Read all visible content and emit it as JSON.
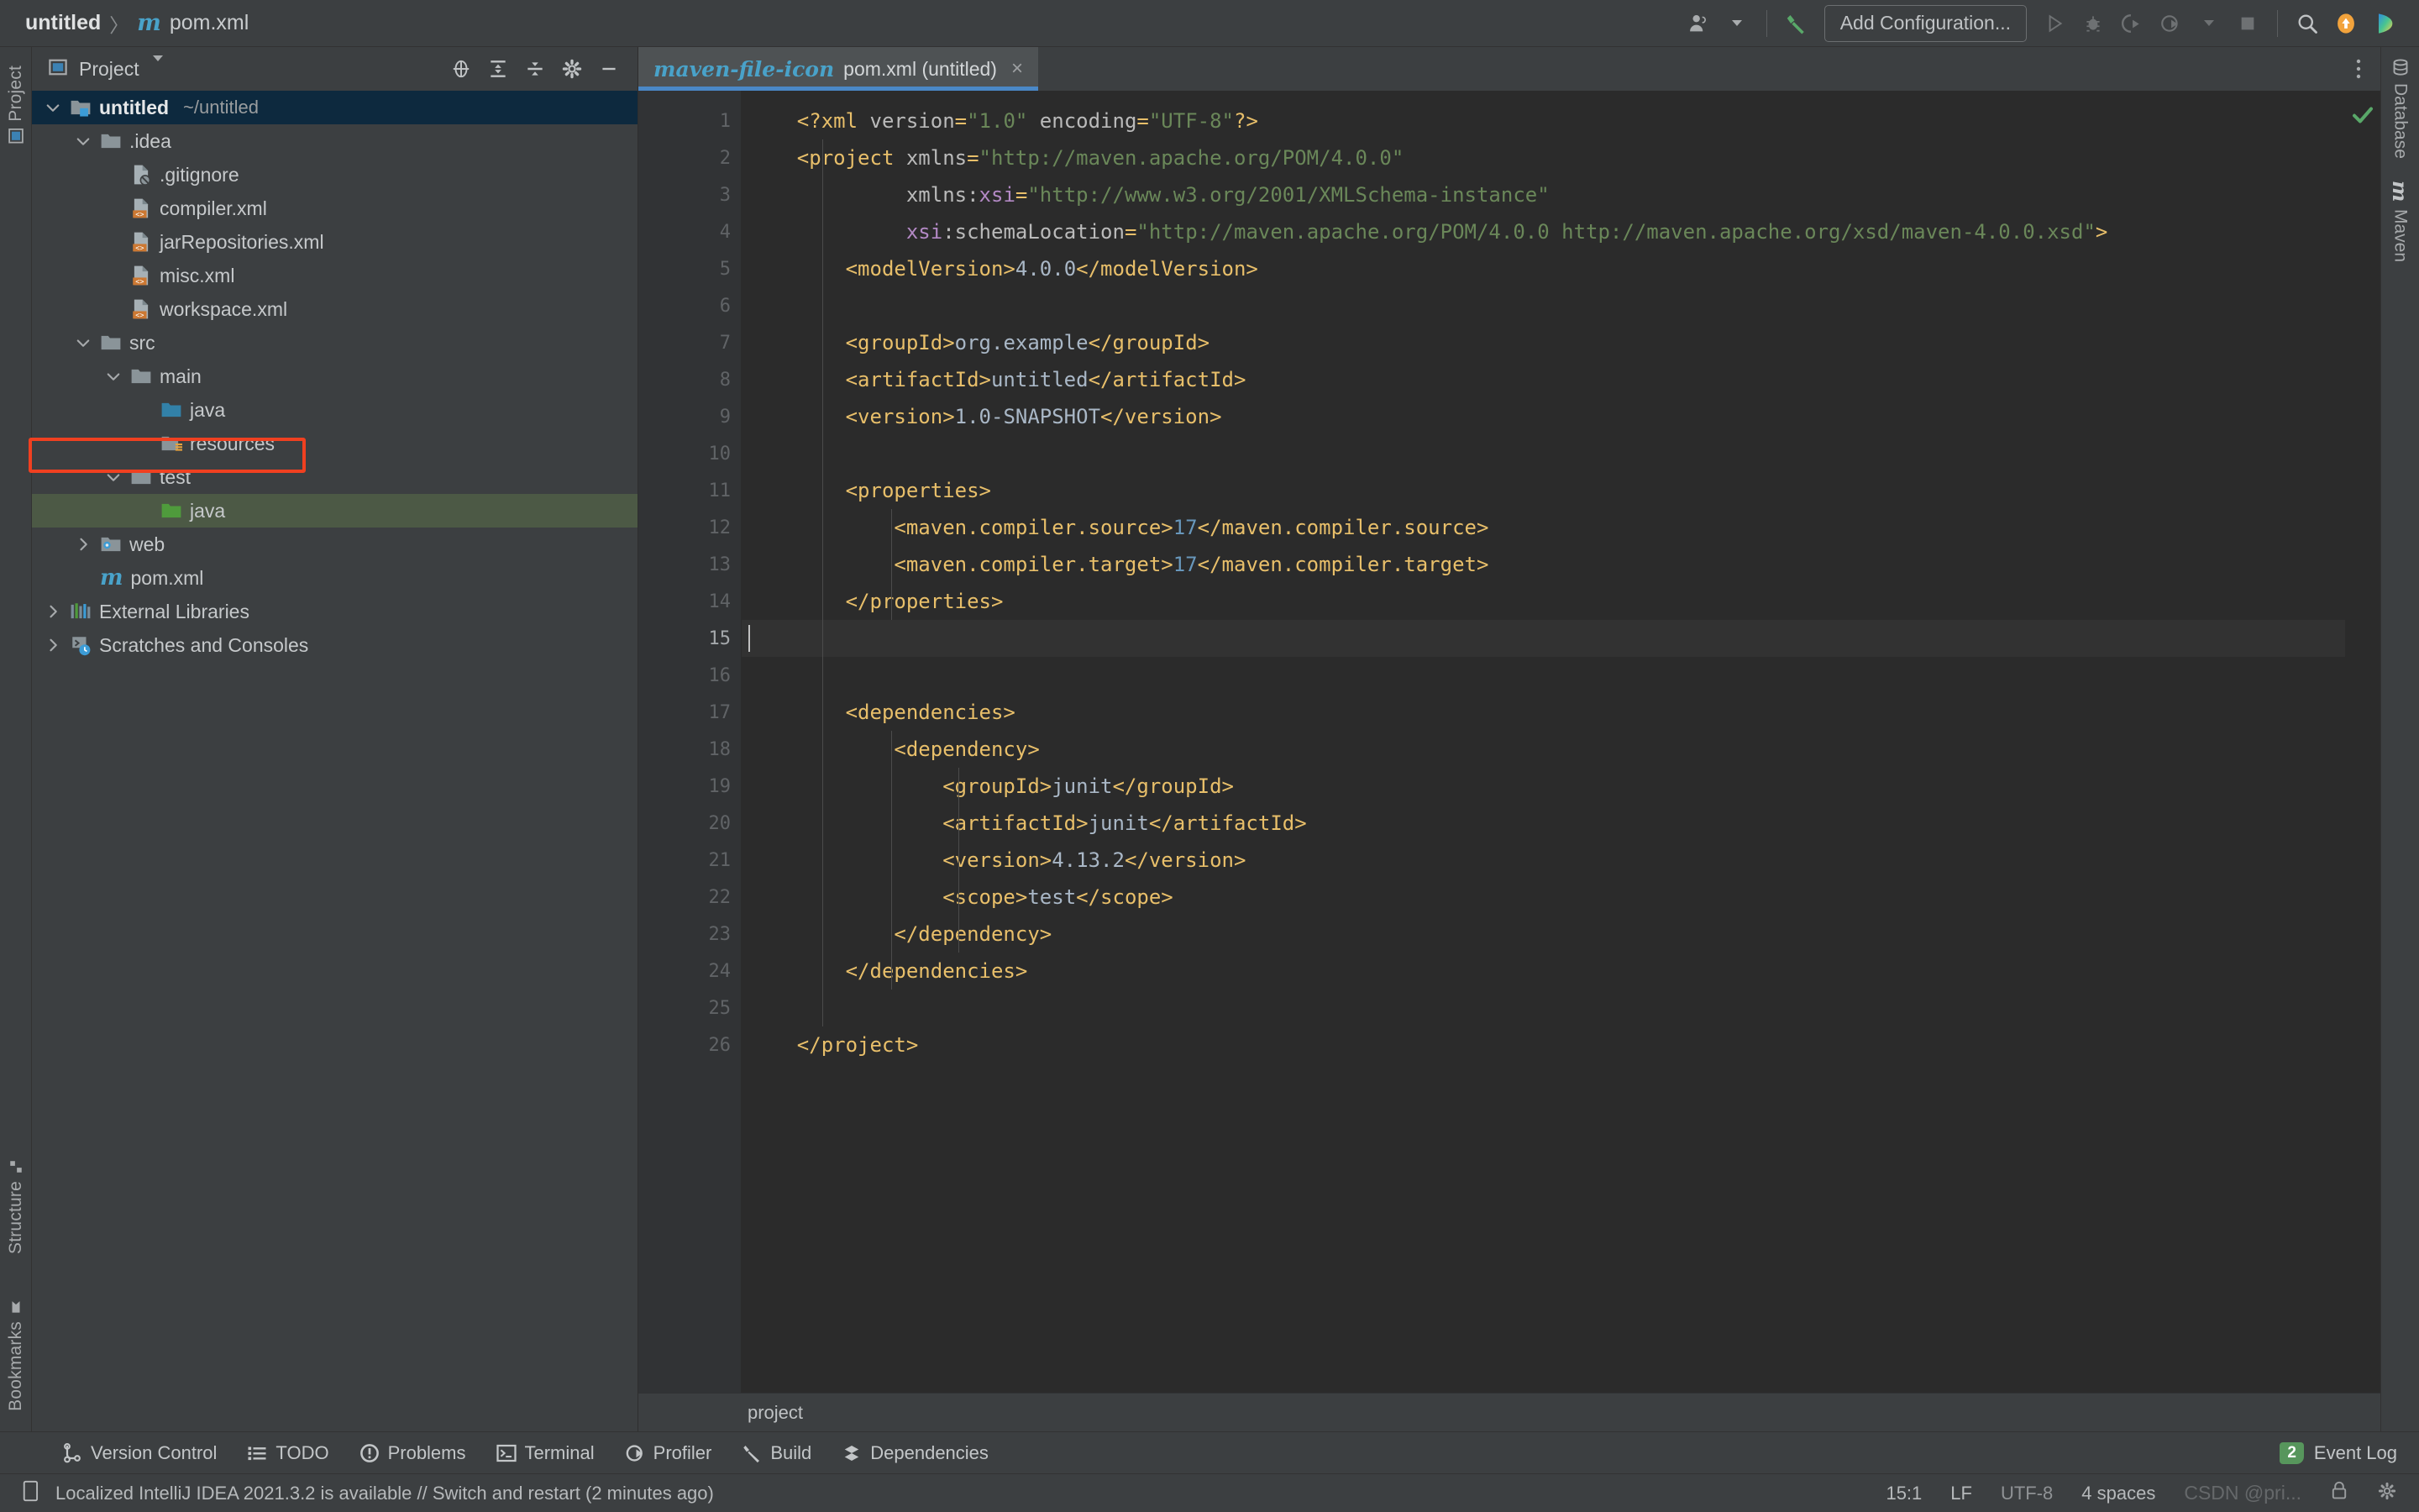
{
  "titlebar": {
    "project_name": "untitled",
    "separator": "〉",
    "file_icon": "m",
    "file_name": "pom.xml",
    "account_icon": "user-account-icon",
    "build_icon": "build-hammer-icon",
    "add_configuration_label": "Add Configuration...",
    "run_icon": "run-icon",
    "debug_icon": "debug-icon",
    "run_coverage_icon": "run-with-coverage-icon",
    "profile_icon": "profile-icon",
    "stop_icon": "stop-icon",
    "search_icon": "search-everywhere-icon",
    "updates_icon": "update-available-icon",
    "ide_icon": "ide-logo-icon"
  },
  "left_strip": {
    "project_label": "Project",
    "structure_label": "Structure",
    "bookmarks_label": "Bookmarks"
  },
  "project_panel": {
    "header_title": "Project",
    "header_dropdown": "▼",
    "icons": [
      {
        "name": "select-opened-file-icon"
      },
      {
        "name": "expand-all-icon"
      },
      {
        "name": "collapse-all-icon"
      },
      {
        "name": "settings-gear-icon"
      },
      {
        "name": "hide-panel-icon"
      }
    ],
    "tree": [
      {
        "depth": 0,
        "arrow": "down",
        "icon": "module-folder-icon",
        "label": "untitled",
        "sub": "~/untitled",
        "bold": true,
        "state": "selected-blue"
      },
      {
        "depth": 1,
        "arrow": "down",
        "icon": "folder-icon",
        "label": ".idea",
        "sub": "",
        "bold": false,
        "state": "none"
      },
      {
        "depth": 2,
        "arrow": "none",
        "icon": "gitignore-file-icon",
        "label": ".gitignore",
        "sub": "",
        "bold": false,
        "state": "none"
      },
      {
        "depth": 2,
        "arrow": "none",
        "icon": "xml-file-icon",
        "label": "compiler.xml",
        "sub": "",
        "bold": false,
        "state": "none"
      },
      {
        "depth": 2,
        "arrow": "none",
        "icon": "xml-file-icon",
        "label": "jarRepositories.xml",
        "sub": "",
        "bold": false,
        "state": "none"
      },
      {
        "depth": 2,
        "arrow": "none",
        "icon": "xml-file-icon",
        "label": "misc.xml",
        "sub": "",
        "bold": false,
        "state": "none"
      },
      {
        "depth": 2,
        "arrow": "none",
        "icon": "xml-file-icon",
        "label": "workspace.xml",
        "sub": "",
        "bold": false,
        "state": "none"
      },
      {
        "depth": 1,
        "arrow": "down",
        "icon": "folder-icon",
        "label": "src",
        "sub": "",
        "bold": false,
        "state": "none"
      },
      {
        "depth": 2,
        "arrow": "down",
        "icon": "folder-icon",
        "label": "main",
        "sub": "",
        "bold": false,
        "state": "none"
      },
      {
        "depth": 3,
        "arrow": "none",
        "icon": "source-root-icon",
        "label": "java",
        "sub": "",
        "bold": false,
        "state": "none"
      },
      {
        "depth": 3,
        "arrow": "none",
        "icon": "resources-root-icon",
        "label": "resources",
        "sub": "",
        "bold": false,
        "state": "none"
      },
      {
        "depth": 2,
        "arrow": "down",
        "icon": "folder-icon",
        "label": "test",
        "sub": "",
        "bold": false,
        "state": "none"
      },
      {
        "depth": 3,
        "arrow": "none",
        "icon": "test-source-root-icon",
        "label": "java",
        "sub": "",
        "bold": false,
        "state": "selected-green"
      },
      {
        "depth": 1,
        "arrow": "right",
        "icon": "web-folder-icon",
        "label": "web",
        "sub": "",
        "bold": false,
        "state": "highlighted-red"
      },
      {
        "depth": 1,
        "arrow": "none",
        "icon": "maven-file-icon",
        "label": "pom.xml",
        "sub": "",
        "bold": false,
        "state": "none"
      },
      {
        "depth": 0,
        "arrow": "right",
        "icon": "external-libraries-icon",
        "label": "External Libraries",
        "sub": "",
        "bold": false,
        "state": "none"
      },
      {
        "depth": 0,
        "arrow": "right",
        "icon": "scratches-icon",
        "label": "Scratches and Consoles",
        "sub": "",
        "bold": false,
        "state": "none"
      }
    ]
  },
  "editor": {
    "tab": {
      "icon": "maven-file-icon",
      "label": "pom.xml (untitled)",
      "close": "×"
    },
    "tab_menu_icon": "more-options-icon",
    "inspection_status_icon": "no-problems-check-icon",
    "breadcrumb": "project",
    "caret_position": "15:1",
    "lines": [
      {
        "n": 1,
        "fold": "",
        "bulb": false,
        "current": false,
        "segs": [
          {
            "c": "txt",
            "t": "    "
          },
          {
            "c": "tag",
            "t": "<?xml "
          },
          {
            "c": "attr",
            "t": "version"
          },
          {
            "c": "tag",
            "t": "="
          },
          {
            "c": "str",
            "t": "\"1.0\""
          },
          {
            "c": "attr",
            "t": " encoding"
          },
          {
            "c": "tag",
            "t": "="
          },
          {
            "c": "str",
            "t": "\"UTF-8\""
          },
          {
            "c": "tag",
            "t": "?>"
          }
        ]
      },
      {
        "n": 2,
        "fold": "open",
        "bulb": false,
        "current": false,
        "segs": [
          {
            "c": "txt",
            "t": "    "
          },
          {
            "c": "tag",
            "t": "<project "
          },
          {
            "c": "attr",
            "t": "xmlns"
          },
          {
            "c": "tag",
            "t": "="
          },
          {
            "c": "str",
            "t": "\"http://maven.apache.org/POM/4.0.0\""
          }
        ]
      },
      {
        "n": 3,
        "fold": "",
        "bulb": false,
        "current": false,
        "segs": [
          {
            "c": "txt",
            "t": "             "
          },
          {
            "c": "attr",
            "t": "xmlns:"
          },
          {
            "c": "ns",
            "t": "xsi"
          },
          {
            "c": "tag",
            "t": "="
          },
          {
            "c": "str",
            "t": "\"http://www.w3.org/2001/XMLSchema-instance\""
          }
        ]
      },
      {
        "n": 4,
        "fold": "",
        "bulb": false,
        "current": false,
        "segs": [
          {
            "c": "txt",
            "t": "             "
          },
          {
            "c": "ns",
            "t": "xsi"
          },
          {
            "c": "attr",
            "t": ":schemaLocation"
          },
          {
            "c": "tag",
            "t": "="
          },
          {
            "c": "str",
            "t": "\"http://maven.apache.org/POM/4.0.0 http://maven.apache.org/xsd/maven-4.0.0.xsd\""
          },
          {
            "c": "tag",
            "t": ">"
          }
        ]
      },
      {
        "n": 5,
        "fold": "",
        "bulb": false,
        "current": false,
        "segs": [
          {
            "c": "txt",
            "t": "        "
          },
          {
            "c": "tag",
            "t": "<modelVersion>"
          },
          {
            "c": "txt",
            "t": "4.0.0"
          },
          {
            "c": "tag",
            "t": "</modelVersion>"
          }
        ]
      },
      {
        "n": 6,
        "fold": "",
        "bulb": false,
        "current": false,
        "segs": []
      },
      {
        "n": 7,
        "fold": "",
        "bulb": false,
        "current": false,
        "segs": [
          {
            "c": "txt",
            "t": "        "
          },
          {
            "c": "tag",
            "t": "<groupId>"
          },
          {
            "c": "txt",
            "t": "org.example"
          },
          {
            "c": "tag",
            "t": "</groupId>"
          }
        ]
      },
      {
        "n": 8,
        "fold": "",
        "bulb": false,
        "current": false,
        "segs": [
          {
            "c": "txt",
            "t": "        "
          },
          {
            "c": "tag",
            "t": "<artifactId>"
          },
          {
            "c": "txt",
            "t": "untitled"
          },
          {
            "c": "tag",
            "t": "</artifactId>"
          }
        ]
      },
      {
        "n": 9,
        "fold": "",
        "bulb": false,
        "current": false,
        "segs": [
          {
            "c": "txt",
            "t": "        "
          },
          {
            "c": "tag",
            "t": "<version>"
          },
          {
            "c": "txt",
            "t": "1.0-SNAPSHOT"
          },
          {
            "c": "tag",
            "t": "</version>"
          }
        ]
      },
      {
        "n": 10,
        "fold": "",
        "bulb": false,
        "current": false,
        "segs": []
      },
      {
        "n": 11,
        "fold": "open",
        "bulb": false,
        "current": false,
        "segs": [
          {
            "c": "txt",
            "t": "        "
          },
          {
            "c": "tag",
            "t": "<properties>"
          }
        ]
      },
      {
        "n": 12,
        "fold": "",
        "bulb": false,
        "current": false,
        "segs": [
          {
            "c": "txt",
            "t": "            "
          },
          {
            "c": "tag",
            "t": "<maven.compiler.source>"
          },
          {
            "c": "num",
            "t": "17"
          },
          {
            "c": "tag",
            "t": "</maven.compiler.source>"
          }
        ]
      },
      {
        "n": 13,
        "fold": "",
        "bulb": false,
        "current": false,
        "segs": [
          {
            "c": "txt",
            "t": "            "
          },
          {
            "c": "tag",
            "t": "<maven.compiler.target>"
          },
          {
            "c": "num",
            "t": "17"
          },
          {
            "c": "tag",
            "t": "</maven.compiler.target>"
          }
        ]
      },
      {
        "n": 14,
        "fold": "close",
        "bulb": true,
        "current": false,
        "segs": [
          {
            "c": "txt",
            "t": "        "
          },
          {
            "c": "tag",
            "t": "</properties>"
          }
        ]
      },
      {
        "n": 15,
        "fold": "",
        "bulb": false,
        "current": true,
        "segs": []
      },
      {
        "n": 16,
        "fold": "",
        "bulb": false,
        "current": false,
        "segs": []
      },
      {
        "n": 17,
        "fold": "open",
        "bulb": false,
        "current": false,
        "segs": [
          {
            "c": "txt",
            "t": "        "
          },
          {
            "c": "tag",
            "t": "<dependencies>"
          }
        ]
      },
      {
        "n": 18,
        "fold": "open",
        "bulb": false,
        "current": false,
        "segs": [
          {
            "c": "txt",
            "t": "            "
          },
          {
            "c": "tag",
            "t": "<dependency>"
          }
        ]
      },
      {
        "n": 19,
        "fold": "",
        "bulb": false,
        "current": false,
        "segs": [
          {
            "c": "txt",
            "t": "                "
          },
          {
            "c": "tag",
            "t": "<groupId>"
          },
          {
            "c": "txt",
            "t": "junit"
          },
          {
            "c": "tag",
            "t": "</groupId>"
          }
        ]
      },
      {
        "n": 20,
        "fold": "",
        "bulb": false,
        "current": false,
        "segs": [
          {
            "c": "txt",
            "t": "                "
          },
          {
            "c": "tag",
            "t": "<artifactId>"
          },
          {
            "c": "txt",
            "t": "junit"
          },
          {
            "c": "tag",
            "t": "</artifactId>"
          }
        ]
      },
      {
        "n": 21,
        "fold": "",
        "bulb": false,
        "current": false,
        "segs": [
          {
            "c": "txt",
            "t": "                "
          },
          {
            "c": "tag",
            "t": "<version>"
          },
          {
            "c": "txt",
            "t": "4.13.2"
          },
          {
            "c": "tag",
            "t": "</version>"
          }
        ]
      },
      {
        "n": 22,
        "fold": "",
        "bulb": false,
        "current": false,
        "segs": [
          {
            "c": "txt",
            "t": "                "
          },
          {
            "c": "tag",
            "t": "<scope>"
          },
          {
            "c": "txt",
            "t": "test"
          },
          {
            "c": "tag",
            "t": "</scope>"
          }
        ]
      },
      {
        "n": 23,
        "fold": "close",
        "bulb": false,
        "current": false,
        "segs": [
          {
            "c": "txt",
            "t": "            "
          },
          {
            "c": "tag",
            "t": "</dependency>"
          }
        ]
      },
      {
        "n": 24,
        "fold": "close",
        "bulb": false,
        "current": false,
        "segs": [
          {
            "c": "txt",
            "t": "        "
          },
          {
            "c": "tag",
            "t": "</dependencies>"
          }
        ]
      },
      {
        "n": 25,
        "fold": "",
        "bulb": false,
        "current": false,
        "segs": []
      },
      {
        "n": 26,
        "fold": "close",
        "bulb": false,
        "current": false,
        "segs": [
          {
            "c": "txt",
            "t": "    "
          },
          {
            "c": "tag",
            "t": "</project>"
          }
        ]
      }
    ]
  },
  "right_strip": {
    "database_label": "Database",
    "maven_label": "Maven"
  },
  "tool_window_bar": {
    "items": [
      {
        "icon": "version-control-icon",
        "label": "Version Control"
      },
      {
        "icon": "todo-list-icon",
        "label": "TODO"
      },
      {
        "icon": "problems-icon",
        "label": "Problems"
      },
      {
        "icon": "terminal-icon",
        "label": "Terminal"
      },
      {
        "icon": "profiler-icon",
        "label": "Profiler"
      },
      {
        "icon": "build-icon",
        "label": "Build"
      },
      {
        "icon": "dependencies-icon",
        "label": "Dependencies"
      }
    ],
    "event_log": {
      "count": "2",
      "label": "Event Log"
    }
  },
  "status_bar": {
    "memory_icon": "notification-icon",
    "message": "Localized IntelliJ IDEA 2021.3.2 is available // Switch and restart (2 minutes ago)",
    "caret": "15:1",
    "line_separator": "LF",
    "encoding": "UTF-8",
    "indent": "4 spaces",
    "watermark": "CSDN @pri...",
    "lock_icon": "read-only-lock-icon",
    "settings_icon": "status-gear-icon"
  },
  "colors": {
    "accent_blue": "#4a88c7",
    "tag_orange": "#e8bf6a",
    "string_green": "#6a8759",
    "number_blue": "#6897bb",
    "namespace_purple": "#b389c5",
    "highlight_red": "#f04020",
    "selection_blue": "#0d293e",
    "selection_green": "#4c5945",
    "bulb_orange": "#f0a732",
    "badge_green": "#57965c"
  }
}
